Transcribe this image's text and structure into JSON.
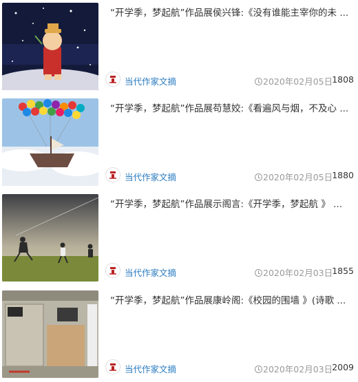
{
  "articles": [
    {
      "title": "“开学季，梦起航”作品展侯兴锋:《没有谁能主宰你的未 ...",
      "author": "当代作家文摘",
      "date": "2020年02月05日",
      "views": "1808",
      "thumbnail": "snoopy-stars"
    },
    {
      "title": "“开学季，梦起航”作品展苟慧姣:《看遍风与烟，不及心 ...",
      "author": "当代作家文摘",
      "date": "2020年02月05日",
      "views": "1880",
      "thumbnail": "balloon-ship"
    },
    {
      "title": "“开学季，梦起航”作品展示阁言:《开学季，梦起航 》 ...",
      "author": "当代作家文摘",
      "date": "2020年02月03日",
      "views": "1855",
      "thumbnail": "kids-kite-field"
    },
    {
      "title": "“开学季，梦起航”作品展康岭阁:《校园的围墙 》(诗歌 ...",
      "author": "当代作家文摘",
      "date": "2020年02月03日",
      "views": "2009",
      "thumbnail": "classroom-wall"
    }
  ],
  "colors": {
    "author_link": "#2a7bc0",
    "meta_gray": "#999999",
    "title_text": "#333333"
  },
  "icons": {
    "date": "clock-icon",
    "avatar": "author-avatar-logo"
  }
}
